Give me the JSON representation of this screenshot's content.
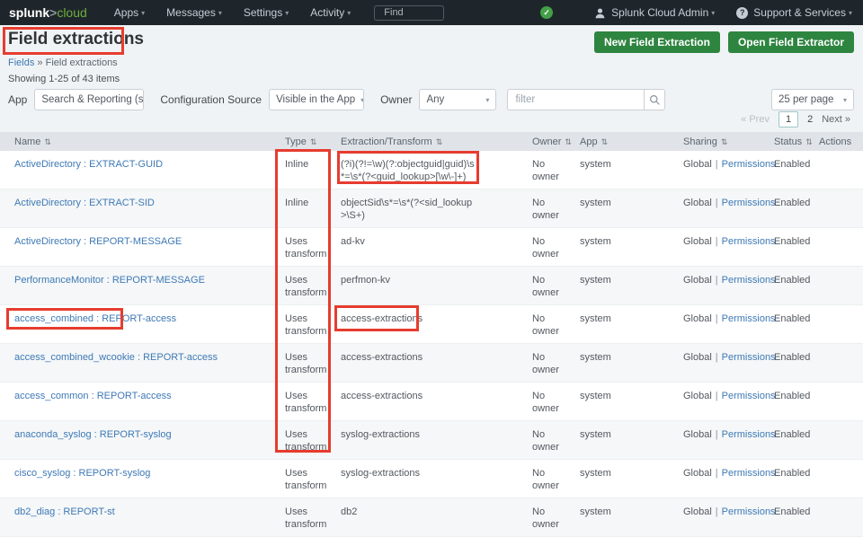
{
  "topnav": {
    "logo": {
      "brand": "splunk",
      "gt": ">",
      "product": "cloud"
    },
    "menus": [
      "Apps",
      "Messages",
      "Settings",
      "Activity"
    ],
    "find_placeholder": "Find",
    "user_menu": "Splunk Cloud Admin",
    "support_menu": "Support & Services"
  },
  "header": {
    "title": "Field extractions",
    "breadcrumb": {
      "parent": "Fields",
      "separator": "»",
      "current": "Field extractions"
    },
    "new_button": "New Field Extraction",
    "open_button": "Open Field Extractor"
  },
  "summary": "Showing 1-25 of 43 items",
  "filters": {
    "app_label": "App",
    "app_value": "Search & Reporting (s...",
    "config_label": "Configuration Source",
    "config_value": "Visible in the App",
    "owner_label": "Owner",
    "owner_value": "Any",
    "filter_placeholder": "filter",
    "per_page": "25 per page"
  },
  "pagination": {
    "prev": "« Prev",
    "current": "1",
    "page2": "2",
    "next": "Next »"
  },
  "table": {
    "columns": [
      {
        "label": "Name",
        "sortable": true
      },
      {
        "label": "Type",
        "sortable": true
      },
      {
        "label": "Extraction/Transform",
        "sortable": true
      },
      {
        "label": "Owner",
        "sortable": true
      },
      {
        "label": "App",
        "sortable": true
      },
      {
        "label": "Sharing",
        "sortable": true
      },
      {
        "label": "Status",
        "sortable": true
      },
      {
        "label": "Actions",
        "sortable": false
      }
    ],
    "rows": [
      {
        "name": "ActiveDirectory : EXTRACT-GUID",
        "type": "Inline",
        "extraction": "(?i)(?!=\\w)(?:objectguid|guid)\\s*=\\s*(?<guid_lookup>[\\w\\-]+)",
        "owner": "No owner",
        "app": "system",
        "sharing": "Global",
        "permissions": "Permissions",
        "status": "Enabled"
      },
      {
        "name": "ActiveDirectory : EXTRACT-SID",
        "type": "Inline",
        "extraction": "objectSid\\s*=\\s*(?<sid_lookup>\\S+)",
        "owner": "No owner",
        "app": "system",
        "sharing": "Global",
        "permissions": "Permissions",
        "status": "Enabled"
      },
      {
        "name": "ActiveDirectory : REPORT-MESSAGE",
        "type": "Uses transform",
        "extraction": "ad-kv",
        "owner": "No owner",
        "app": "system",
        "sharing": "Global",
        "permissions": "Permissions",
        "status": "Enabled"
      },
      {
        "name": "PerformanceMonitor : REPORT-MESSAGE",
        "type": "Uses transform",
        "extraction": "perfmon-kv",
        "owner": "No owner",
        "app": "system",
        "sharing": "Global",
        "permissions": "Permissions",
        "status": "Enabled"
      },
      {
        "name": "access_combined : REPORT-access",
        "type": "Uses transform",
        "extraction": "access-extractions",
        "owner": "No owner",
        "app": "system",
        "sharing": "Global",
        "permissions": "Permissions",
        "status": "Enabled"
      },
      {
        "name": "access_combined_wcookie : REPORT-access",
        "type": "Uses transform",
        "extraction": "access-extractions",
        "owner": "No owner",
        "app": "system",
        "sharing": "Global",
        "permissions": "Permissions",
        "status": "Enabled"
      },
      {
        "name": "access_common : REPORT-access",
        "type": "Uses transform",
        "extraction": "access-extractions",
        "owner": "No owner",
        "app": "system",
        "sharing": "Global",
        "permissions": "Permissions",
        "status": "Enabled"
      },
      {
        "name": "anaconda_syslog : REPORT-syslog",
        "type": "Uses transform",
        "extraction": "syslog-extractions",
        "owner": "No owner",
        "app": "system",
        "sharing": "Global",
        "permissions": "Permissions",
        "status": "Enabled"
      },
      {
        "name": "cisco_syslog : REPORT-syslog",
        "type": "Uses transform",
        "extraction": "syslog-extractions",
        "owner": "No owner",
        "app": "system",
        "sharing": "Global",
        "permissions": "Permissions",
        "status": "Enabled"
      },
      {
        "name": "db2_diag : REPORT-st",
        "type": "Uses transform",
        "extraction": "db2",
        "owner": "No owner",
        "app": "system",
        "sharing": "Global",
        "permissions": "Permissions",
        "status": "Enabled"
      }
    ]
  },
  "colors": {
    "navbar_bg": "#1f262b",
    "logo_green": "#6fae3e",
    "button_green": "#2e8540",
    "link_blue": "#3e79b5",
    "annotation_red": "#e63c2f",
    "status_ok_green": "#43a047",
    "table_header_bg": "#e0e4e9"
  }
}
